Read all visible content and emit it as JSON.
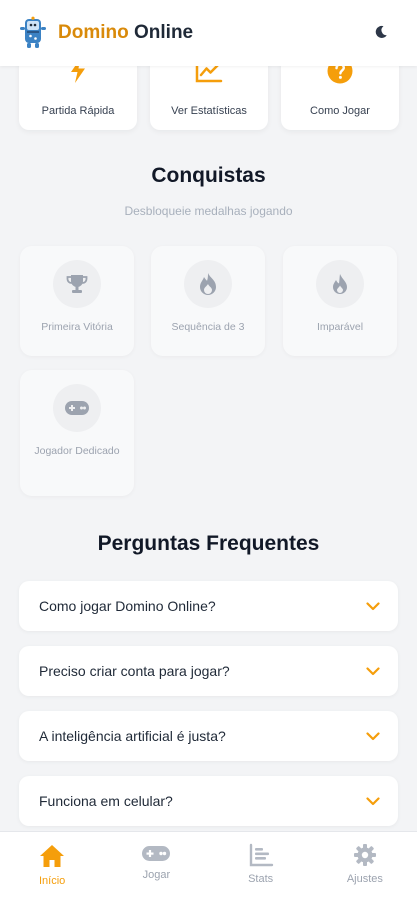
{
  "header": {
    "title_part1": "Domino",
    "title_part2": "Online",
    "logo_icon": "domino-mascot-icon",
    "theme_icon": "moon-icon"
  },
  "quick_actions": [
    {
      "label": "Partida Rápida",
      "icon": "lightning-icon"
    },
    {
      "label": "Ver Estatísticas",
      "icon": "chart-line-icon"
    },
    {
      "label": "Como Jogar",
      "icon": "question-icon"
    }
  ],
  "achievements": {
    "title": "Conquistas",
    "subtitle": "Desbloqueie medalhas jogando",
    "items": [
      {
        "label": "Primeira Vitória",
        "icon": "trophy-icon"
      },
      {
        "label": "Sequência de 3",
        "icon": "flame-icon"
      },
      {
        "label": "Imparável",
        "icon": "fire-drop-icon"
      },
      {
        "label": "Jogador Dedicado",
        "icon": "gamepad-icon"
      }
    ]
  },
  "faq": {
    "title": "Perguntas Frequentes",
    "items": [
      {
        "question": "Como jogar Domino Online?"
      },
      {
        "question": "Preciso criar conta para jogar?"
      },
      {
        "question": "A inteligência artificial é justa?"
      },
      {
        "question": "Funciona em celular?"
      }
    ]
  },
  "nav": {
    "items": [
      {
        "label": "Início",
        "icon": "home-icon",
        "active": true
      },
      {
        "label": "Jogar",
        "icon": "gamepad-icon",
        "active": false
      },
      {
        "label": "Stats",
        "icon": "bar-chart-icon",
        "active": false
      },
      {
        "label": "Ajustes",
        "icon": "gear-icon",
        "active": false
      }
    ]
  },
  "colors": {
    "accent": "#f59e0b",
    "brand_text": "#d98a0a",
    "muted": "#9ca3af",
    "background": "#f3f4f6"
  }
}
